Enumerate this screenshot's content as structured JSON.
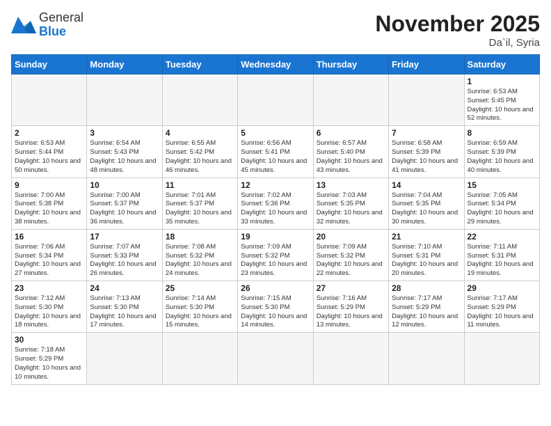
{
  "logo": {
    "text_general": "General",
    "text_blue": "Blue"
  },
  "header": {
    "month_year": "November 2025",
    "location": "Da`il, Syria"
  },
  "weekdays": [
    "Sunday",
    "Monday",
    "Tuesday",
    "Wednesday",
    "Thursday",
    "Friday",
    "Saturday"
  ],
  "days": [
    {
      "num": "",
      "info": ""
    },
    {
      "num": "",
      "info": ""
    },
    {
      "num": "",
      "info": ""
    },
    {
      "num": "",
      "info": ""
    },
    {
      "num": "",
      "info": ""
    },
    {
      "num": "",
      "info": ""
    },
    {
      "num": "1",
      "info": "Sunrise: 6:53 AM\nSunset: 5:45 PM\nDaylight: 10 hours and 52 minutes."
    },
    {
      "num": "2",
      "info": "Sunrise: 6:53 AM\nSunset: 5:44 PM\nDaylight: 10 hours and 50 minutes."
    },
    {
      "num": "3",
      "info": "Sunrise: 6:54 AM\nSunset: 5:43 PM\nDaylight: 10 hours and 48 minutes."
    },
    {
      "num": "4",
      "info": "Sunrise: 6:55 AM\nSunset: 5:42 PM\nDaylight: 10 hours and 46 minutes."
    },
    {
      "num": "5",
      "info": "Sunrise: 6:56 AM\nSunset: 5:41 PM\nDaylight: 10 hours and 45 minutes."
    },
    {
      "num": "6",
      "info": "Sunrise: 6:57 AM\nSunset: 5:40 PM\nDaylight: 10 hours and 43 minutes."
    },
    {
      "num": "7",
      "info": "Sunrise: 6:58 AM\nSunset: 5:39 PM\nDaylight: 10 hours and 41 minutes."
    },
    {
      "num": "8",
      "info": "Sunrise: 6:59 AM\nSunset: 5:39 PM\nDaylight: 10 hours and 40 minutes."
    },
    {
      "num": "9",
      "info": "Sunrise: 7:00 AM\nSunset: 5:38 PM\nDaylight: 10 hours and 38 minutes."
    },
    {
      "num": "10",
      "info": "Sunrise: 7:00 AM\nSunset: 5:37 PM\nDaylight: 10 hours and 36 minutes."
    },
    {
      "num": "11",
      "info": "Sunrise: 7:01 AM\nSunset: 5:37 PM\nDaylight: 10 hours and 35 minutes."
    },
    {
      "num": "12",
      "info": "Sunrise: 7:02 AM\nSunset: 5:36 PM\nDaylight: 10 hours and 33 minutes."
    },
    {
      "num": "13",
      "info": "Sunrise: 7:03 AM\nSunset: 5:35 PM\nDaylight: 10 hours and 32 minutes."
    },
    {
      "num": "14",
      "info": "Sunrise: 7:04 AM\nSunset: 5:35 PM\nDaylight: 10 hours and 30 minutes."
    },
    {
      "num": "15",
      "info": "Sunrise: 7:05 AM\nSunset: 5:34 PM\nDaylight: 10 hours and 29 minutes."
    },
    {
      "num": "16",
      "info": "Sunrise: 7:06 AM\nSunset: 5:34 PM\nDaylight: 10 hours and 27 minutes."
    },
    {
      "num": "17",
      "info": "Sunrise: 7:07 AM\nSunset: 5:33 PM\nDaylight: 10 hours and 26 minutes."
    },
    {
      "num": "18",
      "info": "Sunrise: 7:08 AM\nSunset: 5:32 PM\nDaylight: 10 hours and 24 minutes."
    },
    {
      "num": "19",
      "info": "Sunrise: 7:09 AM\nSunset: 5:32 PM\nDaylight: 10 hours and 23 minutes."
    },
    {
      "num": "20",
      "info": "Sunrise: 7:09 AM\nSunset: 5:32 PM\nDaylight: 10 hours and 22 minutes."
    },
    {
      "num": "21",
      "info": "Sunrise: 7:10 AM\nSunset: 5:31 PM\nDaylight: 10 hours and 20 minutes."
    },
    {
      "num": "22",
      "info": "Sunrise: 7:11 AM\nSunset: 5:31 PM\nDaylight: 10 hours and 19 minutes."
    },
    {
      "num": "23",
      "info": "Sunrise: 7:12 AM\nSunset: 5:30 PM\nDaylight: 10 hours and 18 minutes."
    },
    {
      "num": "24",
      "info": "Sunrise: 7:13 AM\nSunset: 5:30 PM\nDaylight: 10 hours and 17 minutes."
    },
    {
      "num": "25",
      "info": "Sunrise: 7:14 AM\nSunset: 5:30 PM\nDaylight: 10 hours and 15 minutes."
    },
    {
      "num": "26",
      "info": "Sunrise: 7:15 AM\nSunset: 5:30 PM\nDaylight: 10 hours and 14 minutes."
    },
    {
      "num": "27",
      "info": "Sunrise: 7:16 AM\nSunset: 5:29 PM\nDaylight: 10 hours and 13 minutes."
    },
    {
      "num": "28",
      "info": "Sunrise: 7:17 AM\nSunset: 5:29 PM\nDaylight: 10 hours and 12 minutes."
    },
    {
      "num": "29",
      "info": "Sunrise: 7:17 AM\nSunset: 5:29 PM\nDaylight: 10 hours and 11 minutes."
    },
    {
      "num": "30",
      "info": "Sunrise: 7:18 AM\nSunset: 5:29 PM\nDaylight: 10 hours and 10 minutes."
    },
    {
      "num": "",
      "info": ""
    },
    {
      "num": "",
      "info": ""
    },
    {
      "num": "",
      "info": ""
    },
    {
      "num": "",
      "info": ""
    },
    {
      "num": "",
      "info": ""
    },
    {
      "num": "",
      "info": ""
    }
  ]
}
